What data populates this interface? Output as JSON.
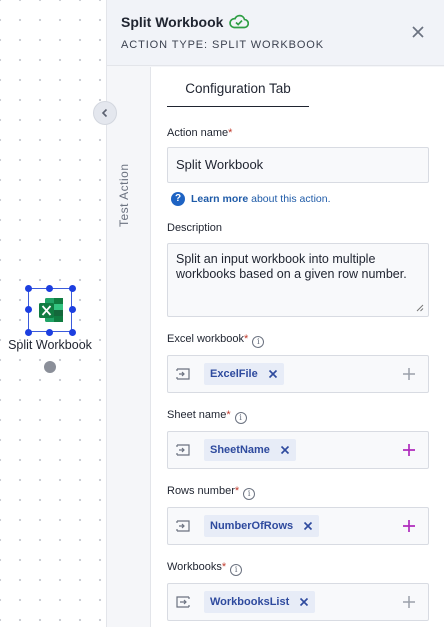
{
  "canvas": {
    "node_label": "Split Workbook",
    "icon": "excel-file-icon"
  },
  "panel": {
    "title": "Split Workbook",
    "action_type": "ACTION TYPE: SPLIT WORKBOOK",
    "status_icon": "cloud-check-icon",
    "side_tab_label": "Test Action",
    "tab_label": "Configuration Tab"
  },
  "form": {
    "action_name_label": "Action name",
    "action_name_value": "Split Workbook",
    "learn_more_strong": "Learn more",
    "learn_more_rest": "about this action.",
    "description_label": "Description",
    "description_value": "Split an input workbook into multiple workbooks based on a given row number.",
    "fields": [
      {
        "label": "Excel workbook",
        "chip": "ExcelFile",
        "plus_active": false
      },
      {
        "label": "Sheet name",
        "chip": "SheetName",
        "plus_active": true
      },
      {
        "label": "Rows number",
        "chip": "NumberOfRows",
        "plus_active": true
      },
      {
        "label": "Workbooks",
        "chip": "WorkbooksList",
        "plus_active": false
      }
    ]
  },
  "colors": {
    "accent_blue": "#1d3fe0",
    "plus_active": "#b02bbd",
    "plus_inactive": "#9aa0aa",
    "cloud_green": "#2e9e44"
  }
}
